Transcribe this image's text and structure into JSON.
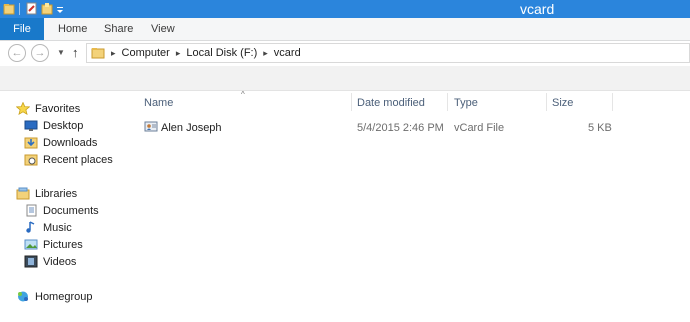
{
  "window": {
    "title": "vcard",
    "accent": "#2b85dc"
  },
  "quick_access": {
    "icons": [
      "folder-icon",
      "properties-icon",
      "new-folder-icon",
      "dropdown-icon"
    ]
  },
  "ribbon": {
    "tabs": [
      {
        "label": "File",
        "active": true
      },
      {
        "label": "Home"
      },
      {
        "label": "Share"
      },
      {
        "label": "View"
      }
    ]
  },
  "navigation": {
    "back_icon": "back-arrow-icon",
    "forward_icon": "forward-arrow-icon",
    "recent_icon": "chevron-down-icon",
    "up_icon": "up-arrow-icon",
    "back_glyph": "←",
    "forward_glyph": "→",
    "recent_glyph": "▼",
    "up_glyph": "↑",
    "breadcrumb": [
      "Computer",
      "Local Disk (F:)",
      "vcard"
    ]
  },
  "nav_pane": {
    "favorites": {
      "label": "Favorites",
      "icon": "star-icon"
    },
    "favorites_items": [
      {
        "label": "Desktop",
        "icon": "desktop-icon"
      },
      {
        "label": "Downloads",
        "icon": "downloads-icon"
      },
      {
        "label": "Recent places",
        "icon": "recent-places-icon"
      }
    ],
    "libraries": {
      "label": "Libraries",
      "icon": "libraries-icon"
    },
    "libraries_items": [
      {
        "label": "Documents",
        "icon": "documents-icon"
      },
      {
        "label": "Music",
        "icon": "music-icon"
      },
      {
        "label": "Pictures",
        "icon": "pictures-icon"
      },
      {
        "label": "Videos",
        "icon": "videos-icon"
      }
    ],
    "homegroup": {
      "label": "Homegroup",
      "icon": "homegroup-icon"
    }
  },
  "file_list": {
    "columns": [
      "Name",
      "Date modified",
      "Type",
      "Size"
    ],
    "sort_glyph": "^",
    "rows": [
      {
        "name": "Alen Joseph",
        "date_modified": "5/4/2015 2:46 PM",
        "type": "vCard File",
        "size": "5 KB",
        "icon": "vcard-icon"
      }
    ]
  }
}
